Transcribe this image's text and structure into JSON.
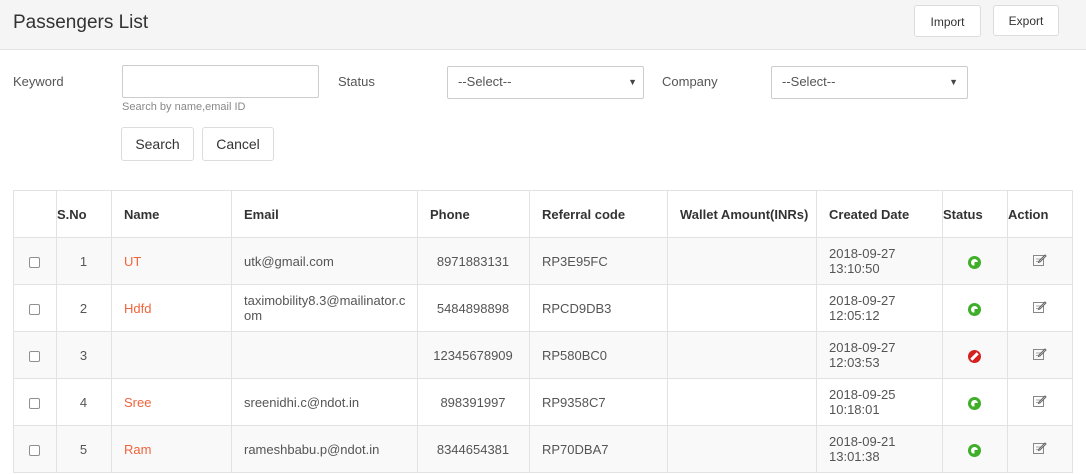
{
  "header": {
    "title": "Passengers List",
    "import_label": "Import",
    "export_label": "Export"
  },
  "filters": {
    "keyword_label": "Keyword",
    "keyword_value": "",
    "keyword_help": "Search by name,email ID",
    "status_label": "Status",
    "status_value": "--Select--",
    "company_label": "Company",
    "company_value": "--Select--",
    "search_label": "Search",
    "cancel_label": "Cancel"
  },
  "table": {
    "headers": {
      "sno": "S.No",
      "name": "Name",
      "email": "Email",
      "phone": "Phone",
      "referral": "Referral code",
      "wallet": "Wallet Amount(INRs)",
      "created": "Created Date",
      "status": "Status",
      "action": "Action"
    },
    "rows": [
      {
        "sno": "1",
        "name": "UT",
        "email": "utk@gmail.com",
        "phone": "8971883131",
        "referral": "RP3E95FC",
        "wallet": "",
        "created_date": "2018-09-27",
        "created_time": "13:10:50",
        "status": "active"
      },
      {
        "sno": "2",
        "name": "Hdfd",
        "email": "taximobility8.3@mailinator.com",
        "phone": "5484898898",
        "referral": "RPCD9DB3",
        "wallet": "",
        "created_date": "2018-09-27",
        "created_time": "12:05:12",
        "status": "active"
      },
      {
        "sno": "3",
        "name": "",
        "email": "",
        "phone": "12345678909",
        "referral": "RP580BC0",
        "wallet": "",
        "created_date": "2018-09-27",
        "created_time": "12:03:53",
        "status": "blocked"
      },
      {
        "sno": "4",
        "name": "Sree",
        "email": "sreenidhi.c@ndot.in",
        "phone": "898391997",
        "referral": "RP9358C7",
        "wallet": "",
        "created_date": "2018-09-25",
        "created_time": "10:18:01",
        "status": "active"
      },
      {
        "sno": "5",
        "name": "Ram",
        "email": "rameshbabu.p@ndot.in",
        "phone": "8344654381",
        "referral": "RP70DBA7",
        "wallet": "",
        "created_date": "2018-09-21",
        "created_time": "13:01:38",
        "status": "active"
      }
    ]
  },
  "icons": {
    "status_active": "status-active-icon",
    "status_blocked": "status-blocked-icon",
    "edit": "edit-icon"
  },
  "colors": {
    "name_link": "#f0643c",
    "active": "#3fae29",
    "blocked": "#d42020"
  }
}
